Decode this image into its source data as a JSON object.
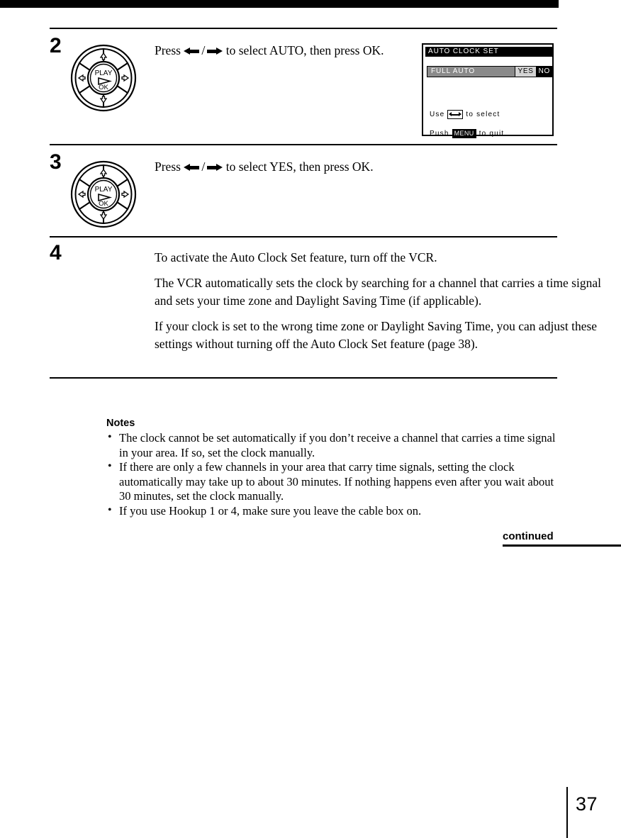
{
  "page": {
    "number": "37",
    "continued_label": "continued"
  },
  "steps": [
    {
      "number": "2",
      "icon": "jog-dial-play-ok",
      "lines": [
        {
          "pre": "Press ",
          "arrows": true,
          "post": " to select AUTO, then press OK."
        }
      ],
      "text_plain": "Press ←/→ to select AUTO, then press OK."
    },
    {
      "number": "3",
      "icon": "jog-dial-play-ok",
      "lines": [
        {
          "pre": "Press ",
          "arrows": true,
          "post": " to select YES, then press OK."
        }
      ],
      "text_plain": "Press ←/→ to select YES, then press OK."
    },
    {
      "number": "4",
      "icon": null,
      "paragraphs": [
        "To activate the Auto Clock Set feature, turn off the VCR.",
        "The VCR automatically sets the clock by searching for a channel that carries a time signal and sets your time zone and Daylight Saving Time (if applicable).",
        "If your clock is set to the wrong time zone or Daylight Saving Time, you can adjust these settings without turning off the Auto Clock Set feature (page 38)."
      ]
    }
  ],
  "jog_dial": {
    "center_top_label": "PLAY",
    "center_bottom_label": "OK",
    "play_symbol": "▷",
    "up_arrow": "⇧",
    "down_arrow": "⇩",
    "left_arrow": "⇦",
    "right_arrow": "⇨"
  },
  "osd": {
    "title": "AUTO  CLOCK  SET",
    "row": {
      "label": "FULL  AUTO",
      "options": [
        {
          "label": "YES",
          "state": "highlighted"
        },
        {
          "label": "NO",
          "state": "selected"
        }
      ]
    },
    "hints": [
      {
        "prefix": "Use",
        "key": "arrows-icon",
        "suffix": "to  select"
      },
      {
        "prefix": "Push",
        "key": "MENU",
        "suffix": "to  quit"
      }
    ],
    "colors": {
      "title_bg": "#000000",
      "title_fg": "#ffffff",
      "row_label_bg": "#8a8a8a",
      "row_label_fg": "#ffffff",
      "option_yes_bg": "#d3d3d3",
      "option_no_bg": "#000000",
      "panel_bg": "#ffffff",
      "border": "#000000"
    }
  },
  "notes": {
    "title": "Notes",
    "bullet": "•",
    "items": [
      "The clock cannot be set automatically if you don’t receive a channel that carries a time signal in your area.  If so, set the clock manually.",
      "If there are only a few channels in your area that carry time signals, setting the clock automatically may take up to about 30 minutes.  If nothing happens even after you wait about 30 minutes, set the clock manually.",
      "If you use Hookup 1 or 4, make sure you leave the cable box on."
    ]
  }
}
